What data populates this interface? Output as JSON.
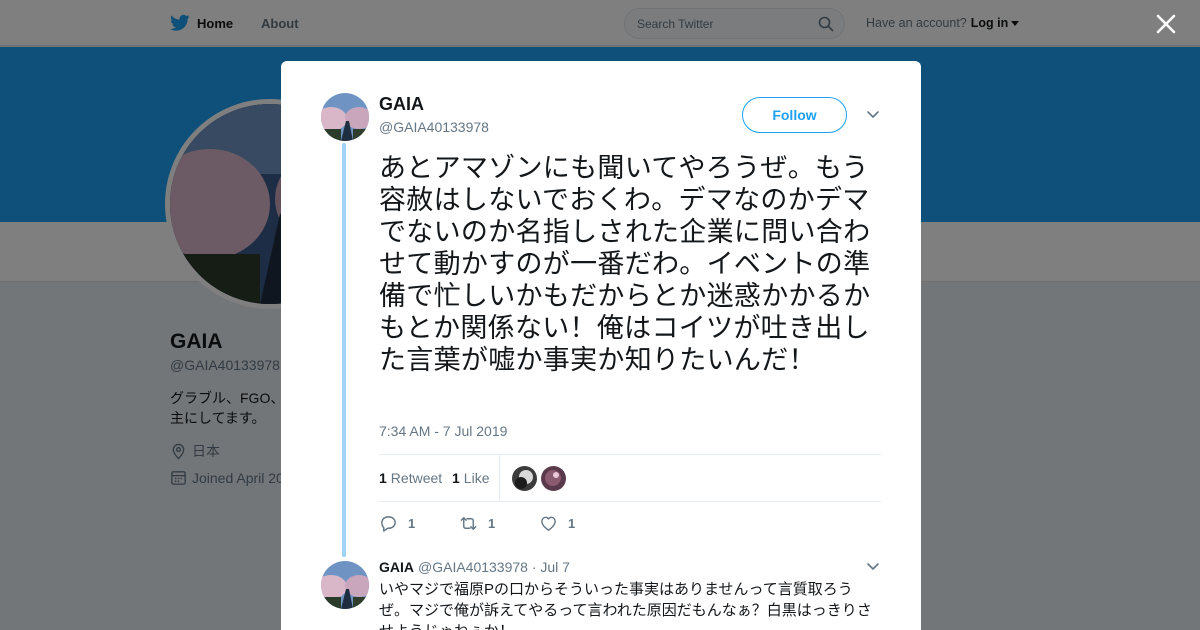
{
  "colors": {
    "accent": "#1da1f2",
    "thread_line": "#a0d3f5",
    "text_secondary": "#657786"
  },
  "topbar": {
    "home_label": "Home",
    "about_label": "About",
    "search_placeholder": "Search Twitter",
    "account_prompt": "Have an account?",
    "login_label": "Log in",
    "icons": [
      "twitter-bird-icon",
      "search-icon",
      "chevron-down-icon",
      "close-icon"
    ]
  },
  "profile": {
    "name": "GAIA",
    "handle": "@GAIA40133978",
    "bio": "グラブル、FGO、\n主にしてます。",
    "location": "日本",
    "joined": "Joined April 20"
  },
  "tweet": {
    "name": "GAIA",
    "handle": "@GAIA40133978",
    "follow_label": "Follow",
    "text": "あとアマゾンにも聞いてやろうぜ。もう容赦はしないでおくわ。デマなのかデマでないのか名指しされた企業に問い合わせて動かすのが一番だわ。イベントの準備で忙しいかもだからとか迷惑かかるかもとか関係ない！俺はコイツが吐き出した言葉が嘘か事実か知りたいんだ！",
    "timestamp": "7:34 AM - 7 Jul 2019",
    "retweet_count": "1",
    "retweet_label": "Retweet",
    "like_count": "1",
    "like_label": "Like",
    "reply_action_count": "1",
    "retweet_action_count": "1",
    "like_action_count": "1"
  },
  "reply": {
    "name": "GAIA",
    "handle_date": "@GAIA40133978 · Jul 7",
    "text": "いやマジで福原Pの口からそういった事実はありませんって言質取ろうぜ。マジで俺が訴えてやるって言われた原因だもんなぁ？白黒はっきりさせようじゃねぇか！"
  }
}
